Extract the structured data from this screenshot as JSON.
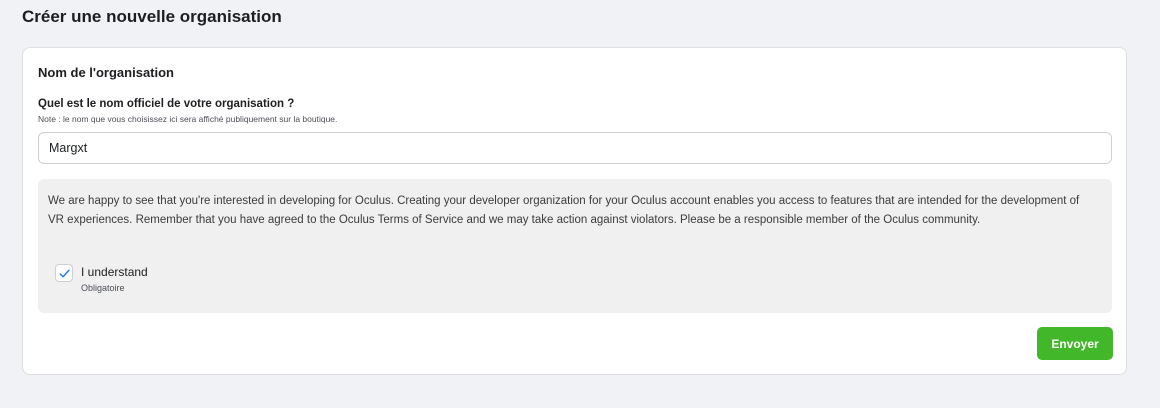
{
  "page": {
    "title": "Créer une nouvelle organisation"
  },
  "card": {
    "section_title": "Nom de l'organisation",
    "question": "Quel est le nom officiel de votre organisation ?",
    "note": "Note : le nom que vous choisissez ici sera affiché publiquement sur la boutique.",
    "name_input": {
      "value": "Margxt",
      "placeholder": ""
    },
    "info": {
      "text": "We are happy to see that you're interested in developing for Oculus. Creating your developer organization for your Oculus account enables you access to features that are intended for the development of VR experiences. Remember that you have agreed to the Oculus Terms of Service and we may take action against violators. Please be a responsible member of the Oculus community.",
      "checkbox": {
        "label": "I understand",
        "required_text": "Obligatoire",
        "checked": true
      }
    },
    "submit_label": "Envoyer"
  },
  "colors": {
    "background": "#f0f2f5",
    "card": "#ffffff",
    "info_panel": "#f0f0f0",
    "submit_button": "#42b72a",
    "checkmark": "#1877f2"
  },
  "icons": {
    "checkbox_check": "checkmark-icon"
  }
}
